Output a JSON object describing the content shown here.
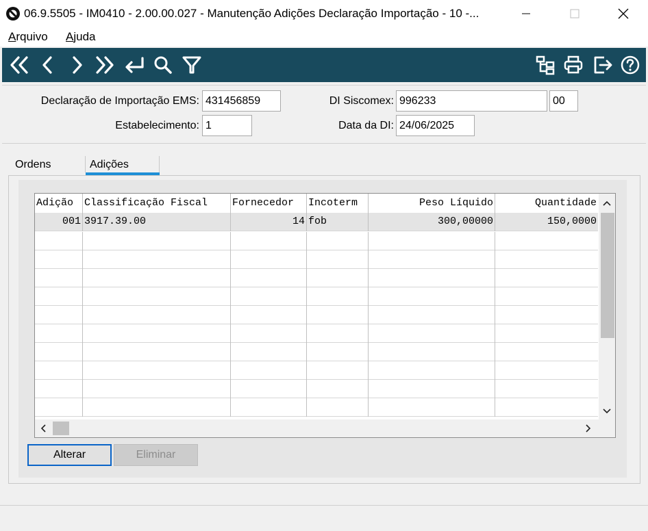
{
  "window": {
    "title": "06.9.5505 - IM0410 - 2.00.00.027 - Manutenção Adições Declaração Importação - 10 -...",
    "minimize_label": "—",
    "maximize_label": "☐",
    "close_label": "✕"
  },
  "menu": {
    "arquivo_u": "A",
    "arquivo_rest": "rquivo",
    "ajuda_u": "A",
    "ajuda_rest": "juda"
  },
  "toolbar": {
    "color": "#184a5d",
    "icons": [
      "first-icon",
      "previous-icon",
      "next-icon",
      "last-icon",
      "goto-icon",
      "search-icon",
      "filter-icon",
      "hierarchy-icon",
      "print-icon",
      "exit-icon",
      "help-icon"
    ]
  },
  "header": {
    "di_ems_label": "Declaração de Importação EMS:",
    "di_ems_value": "431456859",
    "di_siscomex_label": "DI Siscomex:",
    "di_siscomex_value": "996233",
    "di_siscomex_suffix": "00",
    "estabelecimento_label": "Estabelecimento:",
    "estabelecimento_value": "1",
    "data_di_label": "Data da DI:",
    "data_di_value": "24/06/2025"
  },
  "tabs": {
    "ordens": "Ordens",
    "adicoes": "Adições",
    "active": "Adições"
  },
  "grid": {
    "columns": [
      "Adição",
      "Classificação Fiscal",
      "Fornecedor",
      "Incoterm",
      "Peso Líquido",
      "Quantidade"
    ],
    "rows": [
      [
        "001",
        "3917.39.00",
        "14",
        "fob",
        "300,00000",
        "150,0000"
      ]
    ],
    "empty_rows": 10,
    "scroll_up": "∧",
    "scroll_down": "∨",
    "scroll_left": "<",
    "scroll_right": ">"
  },
  "buttons": {
    "alterar": "Alterar",
    "eliminar": "Eliminar"
  }
}
